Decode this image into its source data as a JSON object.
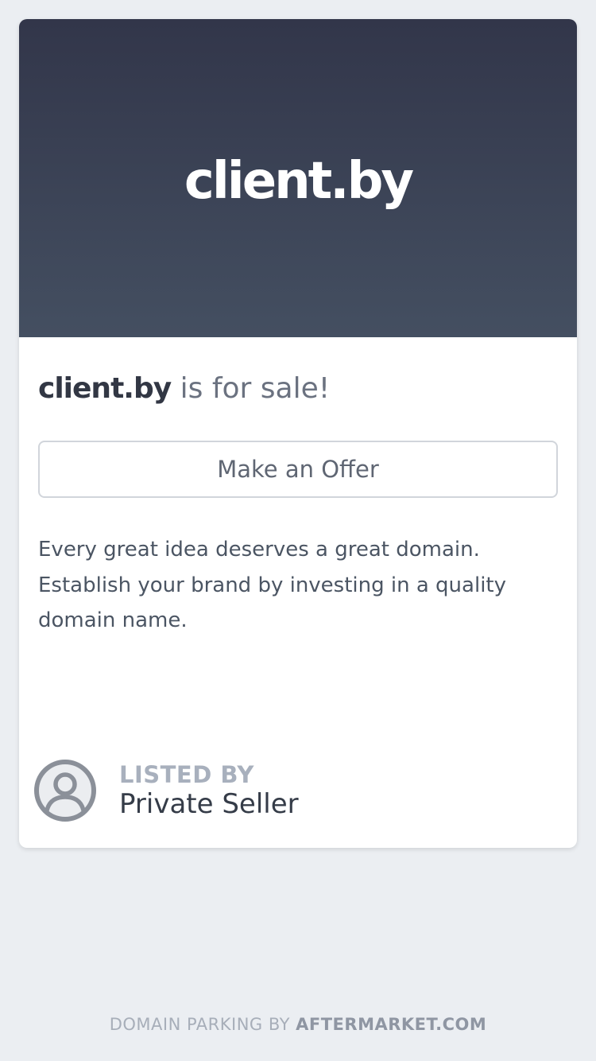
{
  "hero": {
    "domain": "client.by"
  },
  "headline": {
    "domain": "client.by",
    "suffix": " is for sale!"
  },
  "offer_button": {
    "label": "Make an Offer"
  },
  "description": {
    "text": "Every great idea deserves a great domain. Establish your brand by investing in a quality domain name."
  },
  "seller": {
    "listed_by_label": "LISTED BY",
    "name": "Private Seller",
    "avatar_icon": "user-circle-icon"
  },
  "footer": {
    "prefix": "DOMAIN PARKING BY ",
    "brand": "AFTERMARKET.COM"
  },
  "colors": {
    "hero_gradient_top": "#32364a",
    "hero_gradient_bottom": "#444f61",
    "background": "#ebeef2",
    "card": "#ffffff"
  }
}
